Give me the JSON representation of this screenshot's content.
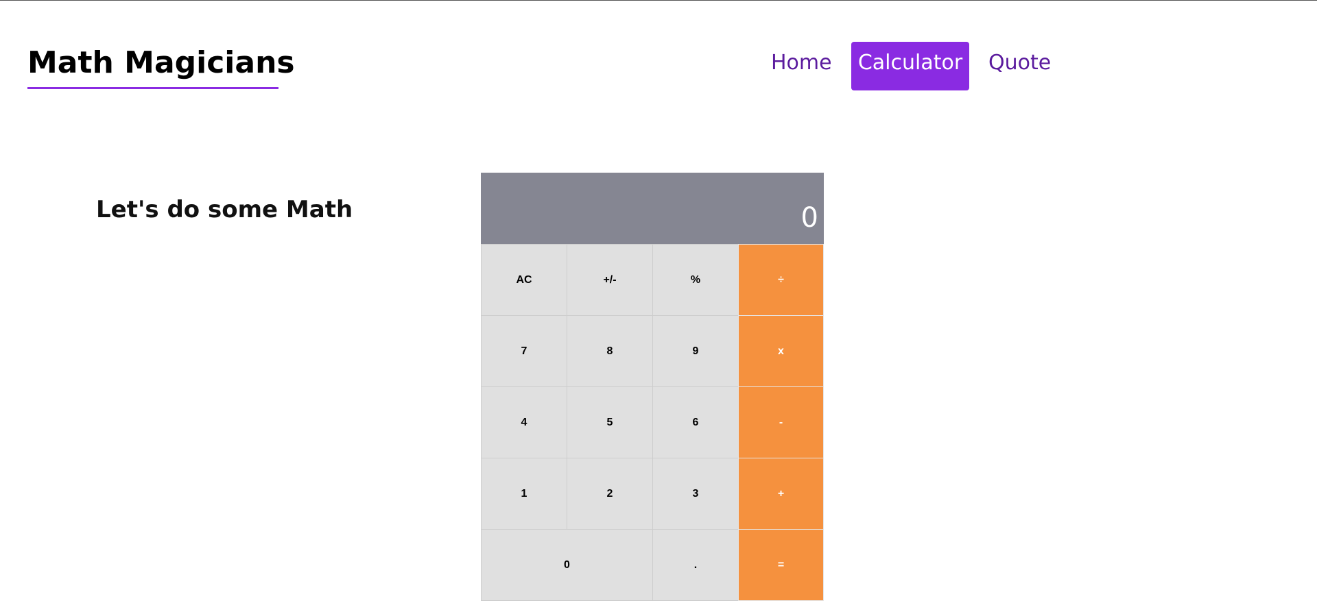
{
  "header": {
    "brand": "Math Magicians",
    "nav": [
      {
        "label": "Home",
        "active": false
      },
      {
        "label": "Calculator",
        "active": true
      },
      {
        "label": "Quote",
        "active": false
      }
    ]
  },
  "main": {
    "headline": "Let's do some Math"
  },
  "calculator": {
    "display": "0",
    "keys": {
      "ac": "AC",
      "sign": "+/-",
      "percent": "%",
      "divide": "÷",
      "seven": "7",
      "eight": "8",
      "nine": "9",
      "multiply": "x",
      "four": "4",
      "five": "5",
      "six": "6",
      "minus": "-",
      "one": "1",
      "two": "2",
      "three": "3",
      "plus": "+",
      "zero": "0",
      "dot": ".",
      "equals": "="
    }
  },
  "colors": {
    "accent": "#8a2be2",
    "nav_text": "#5b1b9e",
    "display_bg": "#858692",
    "key_bg": "#e0e0e0",
    "operator_bg": "#f5913e"
  }
}
